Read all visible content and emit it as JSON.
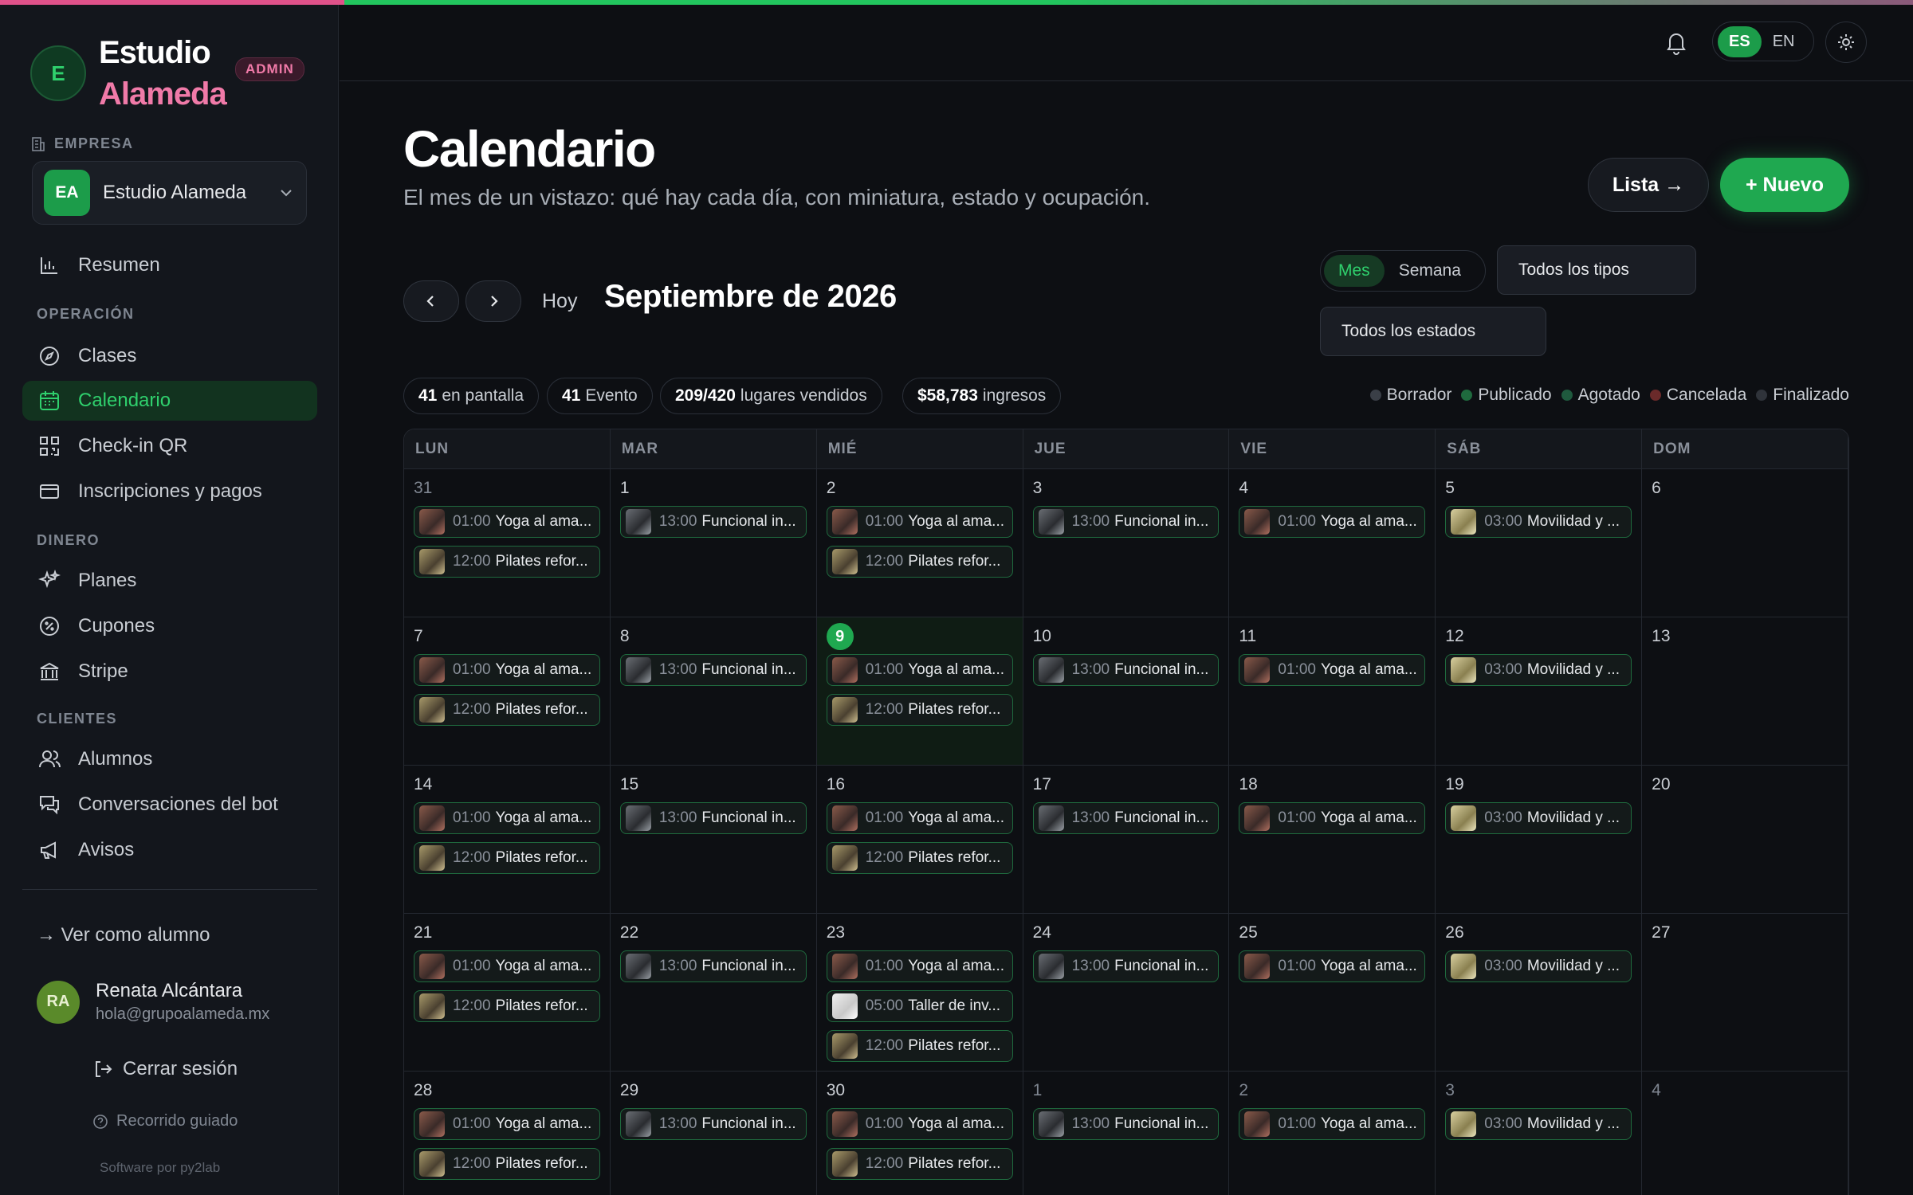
{
  "brand": {
    "initial": "E",
    "line1": "Estudio",
    "line2": "Alameda",
    "badge": "ADMIN"
  },
  "company": {
    "label": "EMPRESA",
    "avatar": "EA",
    "name": "Estudio Alameda"
  },
  "nav": {
    "resumen": "Resumen",
    "section_operacion": "OPERACIÓN",
    "clases": "Clases",
    "calendario": "Calendario",
    "checkin": "Check-in QR",
    "inscripciones": "Inscripciones y pagos",
    "section_dinero": "DINERO",
    "planes": "Planes",
    "cupones": "Cupones",
    "stripe": "Stripe",
    "section_clientes": "CLIENTES",
    "alumnos": "Alumnos",
    "conversaciones": "Conversaciones del bot",
    "avisos": "Avisos"
  },
  "sidebar_footer": {
    "ver_alumno": "→ Ver como alumno",
    "user_initials": "RA",
    "user_name": "Renata Alcántara",
    "user_email": "hola@grupoalameda.mx",
    "logout": "Cerrar sesión",
    "tour": "Recorrido guiado",
    "software": "Software por py2lab"
  },
  "header": {
    "lang_es": "ES",
    "lang_en": "EN"
  },
  "page": {
    "title": "Calendario",
    "subtitle": "El mes de un vistazo: qué hay cada día, con miniatura, estado y ocupación.",
    "btn_lista": "Lista →",
    "btn_nuevo": "+ Nuevo",
    "hoy": "Hoy",
    "month": "Septiembre de 2026",
    "view_mes": "Mes",
    "view_semana": "Semana",
    "filter_tipos": "Todos los tipos",
    "filter_estados": "Todos los estados"
  },
  "stats": {
    "pantalla_n": "41",
    "pantalla_l": "en pantalla",
    "evento_n": "41",
    "evento_l": "Evento",
    "lugares_n": "209/420",
    "lugares_l": "lugares vendidos",
    "ingresos_n": "$58,783",
    "ingresos_l": "ingresos"
  },
  "legend": [
    {
      "label": "Borrador",
      "color": "#3a3f47"
    },
    {
      "label": "Publicado",
      "color": "#1f6a3e"
    },
    {
      "label": "Agotado",
      "color": "#1f5a3e"
    },
    {
      "label": "Cancelada",
      "color": "#6a2a2a"
    },
    {
      "label": "Finalizado",
      "color": "#2f333a"
    }
  ],
  "weekdays": [
    "LUN",
    "MAR",
    "MIÉ",
    "JUE",
    "VIE",
    "SÁB",
    "DOM"
  ],
  "days": [
    {
      "d": "31",
      "other": true,
      "ev": [
        [
          "yoga",
          "01:00",
          "Yoga al ama..."
        ],
        [
          "pil",
          "12:00",
          "Pilates refor..."
        ]
      ]
    },
    {
      "d": "1",
      "ev": [
        [
          "func",
          "13:00",
          "Funcional in..."
        ]
      ]
    },
    {
      "d": "2",
      "ev": [
        [
          "yoga",
          "01:00",
          "Yoga al ama..."
        ],
        [
          "pil",
          "12:00",
          "Pilates refor..."
        ]
      ]
    },
    {
      "d": "3",
      "ev": [
        [
          "func",
          "13:00",
          "Funcional in..."
        ]
      ]
    },
    {
      "d": "4",
      "ev": [
        [
          "yoga",
          "01:00",
          "Yoga al ama..."
        ]
      ]
    },
    {
      "d": "5",
      "ev": [
        [
          "mov",
          "03:00",
          "Movilidad y ..."
        ]
      ]
    },
    {
      "d": "6",
      "ev": []
    },
    {
      "d": "7",
      "ev": [
        [
          "yoga",
          "01:00",
          "Yoga al ama..."
        ],
        [
          "pil",
          "12:00",
          "Pilates refor..."
        ]
      ]
    },
    {
      "d": "8",
      "ev": [
        [
          "func",
          "13:00",
          "Funcional in..."
        ]
      ]
    },
    {
      "d": "9",
      "today": true,
      "ev": [
        [
          "yoga",
          "01:00",
          "Yoga al ama..."
        ],
        [
          "pil",
          "12:00",
          "Pilates refor..."
        ]
      ]
    },
    {
      "d": "10",
      "ev": [
        [
          "func",
          "13:00",
          "Funcional in..."
        ]
      ]
    },
    {
      "d": "11",
      "ev": [
        [
          "yoga",
          "01:00",
          "Yoga al ama..."
        ]
      ]
    },
    {
      "d": "12",
      "ev": [
        [
          "mov",
          "03:00",
          "Movilidad y ..."
        ]
      ]
    },
    {
      "d": "13",
      "ev": []
    },
    {
      "d": "14",
      "ev": [
        [
          "yoga",
          "01:00",
          "Yoga al ama..."
        ],
        [
          "pil",
          "12:00",
          "Pilates refor..."
        ]
      ]
    },
    {
      "d": "15",
      "ev": [
        [
          "func",
          "13:00",
          "Funcional in..."
        ]
      ]
    },
    {
      "d": "16",
      "ev": [
        [
          "yoga",
          "01:00",
          "Yoga al ama..."
        ],
        [
          "pil",
          "12:00",
          "Pilates refor..."
        ]
      ]
    },
    {
      "d": "17",
      "ev": [
        [
          "func",
          "13:00",
          "Funcional in..."
        ]
      ]
    },
    {
      "d": "18",
      "ev": [
        [
          "yoga",
          "01:00",
          "Yoga al ama..."
        ]
      ]
    },
    {
      "d": "19",
      "ev": [
        [
          "mov",
          "03:00",
          "Movilidad y ..."
        ]
      ]
    },
    {
      "d": "20",
      "ev": []
    },
    {
      "d": "21",
      "ev": [
        [
          "yoga",
          "01:00",
          "Yoga al ama..."
        ],
        [
          "pil",
          "12:00",
          "Pilates refor..."
        ]
      ]
    },
    {
      "d": "22",
      "ev": [
        [
          "func",
          "13:00",
          "Funcional in..."
        ]
      ]
    },
    {
      "d": "23",
      "ev": [
        [
          "yoga",
          "01:00",
          "Yoga al ama..."
        ],
        [
          "tall",
          "05:00",
          "Taller de inv..."
        ],
        [
          "pil",
          "12:00",
          "Pilates refor..."
        ]
      ]
    },
    {
      "d": "24",
      "ev": [
        [
          "func",
          "13:00",
          "Funcional in..."
        ]
      ]
    },
    {
      "d": "25",
      "ev": [
        [
          "yoga",
          "01:00",
          "Yoga al ama..."
        ]
      ]
    },
    {
      "d": "26",
      "ev": [
        [
          "mov",
          "03:00",
          "Movilidad y ..."
        ]
      ]
    },
    {
      "d": "27",
      "ev": []
    },
    {
      "d": "28",
      "ev": [
        [
          "yoga",
          "01:00",
          "Yoga al ama..."
        ],
        [
          "pil",
          "12:00",
          "Pilates refor..."
        ]
      ]
    },
    {
      "d": "29",
      "ev": [
        [
          "func",
          "13:00",
          "Funcional in..."
        ]
      ]
    },
    {
      "d": "30",
      "ev": [
        [
          "yoga",
          "01:00",
          "Yoga al ama..."
        ],
        [
          "pil",
          "12:00",
          "Pilates refor..."
        ]
      ]
    },
    {
      "d": "1",
      "other": true,
      "ev": [
        [
          "func",
          "13:00",
          "Funcional in..."
        ]
      ]
    },
    {
      "d": "2",
      "other": true,
      "ev": [
        [
          "yoga",
          "01:00",
          "Yoga al ama..."
        ]
      ]
    },
    {
      "d": "3",
      "other": true,
      "ev": [
        [
          "mov",
          "03:00",
          "Movilidad y ..."
        ]
      ]
    },
    {
      "d": "4",
      "other": true,
      "ev": []
    }
  ]
}
